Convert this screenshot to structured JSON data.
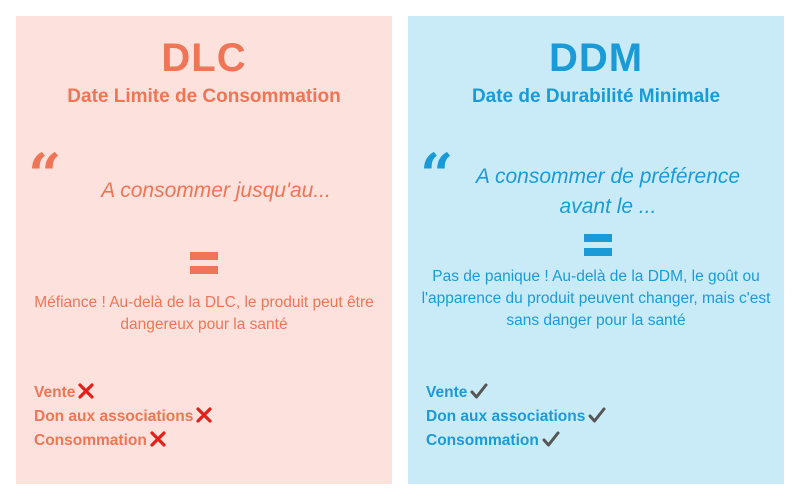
{
  "dlc": {
    "abbr": "DLC",
    "full_name": "Date Limite de Consommation",
    "quote": "A consommer jusqu'au...",
    "description": "Méfiance ! Au-delà de la DLC, le produit peut être dangereux pour la santé",
    "criteria": [
      {
        "label": "Vente",
        "allowed": false
      },
      {
        "label": "Don aux associations",
        "allowed": false
      },
      {
        "label": "Consommation",
        "allowed": false
      }
    ]
  },
  "ddm": {
    "abbr": "DDM",
    "full_name": "Date de Durabilité Minimale",
    "quote": "A consommer de préférence avant le ...",
    "description": "Pas de panique ! Au-delà de la DDM, le goût ou l'apparence du produit peuvent changer, mais c'est sans danger pour la santé",
    "criteria": [
      {
        "label": "Vente",
        "allowed": true
      },
      {
        "label": "Don aux associations",
        "allowed": true
      },
      {
        "label": "Consommation",
        "allowed": true
      }
    ]
  },
  "colors": {
    "dlc_background": "#fde1dc",
    "dlc_accent": "#ef7556",
    "ddm_background": "#c9ebf8",
    "ddm_accent": "#1a9bd7",
    "cross": "#e0201b",
    "check": "#555555"
  },
  "icons": {
    "quote": "opening-quote-icon",
    "equals": "equals-icon",
    "not_allowed": "cross-icon",
    "allowed": "check-icon"
  }
}
